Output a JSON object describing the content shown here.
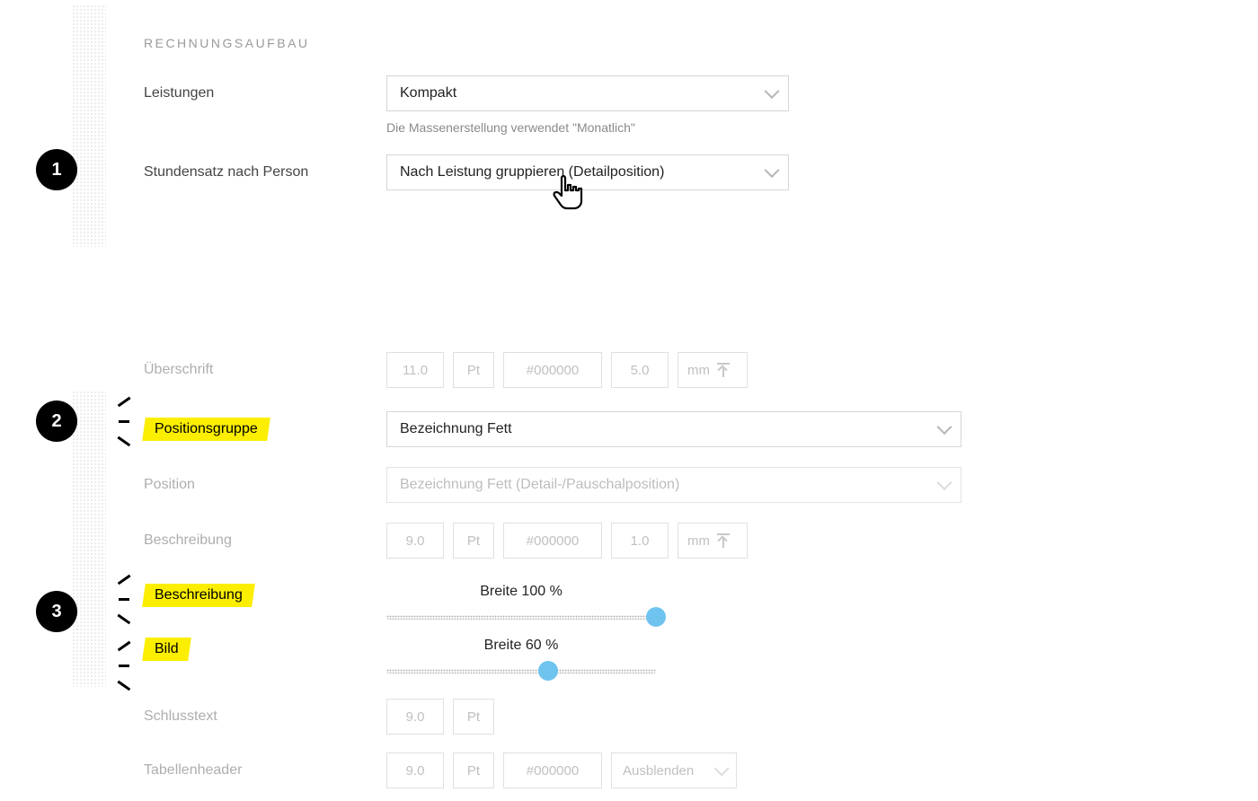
{
  "section1": {
    "title": "RECHNUNGSAUFBAU",
    "leistungen": {
      "label": "Leistungen",
      "value": "Kompakt",
      "help": "Die Massenerstellung verwendet \"Monatlich\""
    },
    "stundensatz": {
      "label": "Stundensatz nach Person",
      "value": "Nach Leistung gruppieren (Detailposition)"
    }
  },
  "section2": {
    "ueberschrift": {
      "label": "Überschrift",
      "size": "11.0",
      "unit": "Pt",
      "hex": "#000000",
      "margin": "5.0",
      "marginUnit": "mm"
    },
    "positionsgruppe": {
      "label": "Positionsgruppe",
      "value": "Bezeichnung Fett"
    },
    "position": {
      "label": "Position",
      "value": "Bezeichnung Fett (Detail-/Pauschalposition)"
    },
    "beschreibung": {
      "label": "Beschreibung",
      "size": "9.0",
      "unit": "Pt",
      "hex": "#000000",
      "margin": "1.0",
      "marginUnit": "mm"
    },
    "sliderBeschreibung": {
      "label": "Beschreibung",
      "caption": "Breite 100 %",
      "percent": 100
    },
    "sliderBild": {
      "label": "Bild",
      "caption": "Breite 60 %",
      "percent": 60
    },
    "schlusstext": {
      "label": "Schlusstext",
      "size": "9.0",
      "unit": "Pt"
    },
    "tabellenheader": {
      "label": "Tabellenheader",
      "size": "9.0",
      "unit": "Pt",
      "hex": "#000000",
      "option": "Ausblenden"
    }
  },
  "badges": {
    "one": "1",
    "two": "2",
    "three": "3"
  }
}
